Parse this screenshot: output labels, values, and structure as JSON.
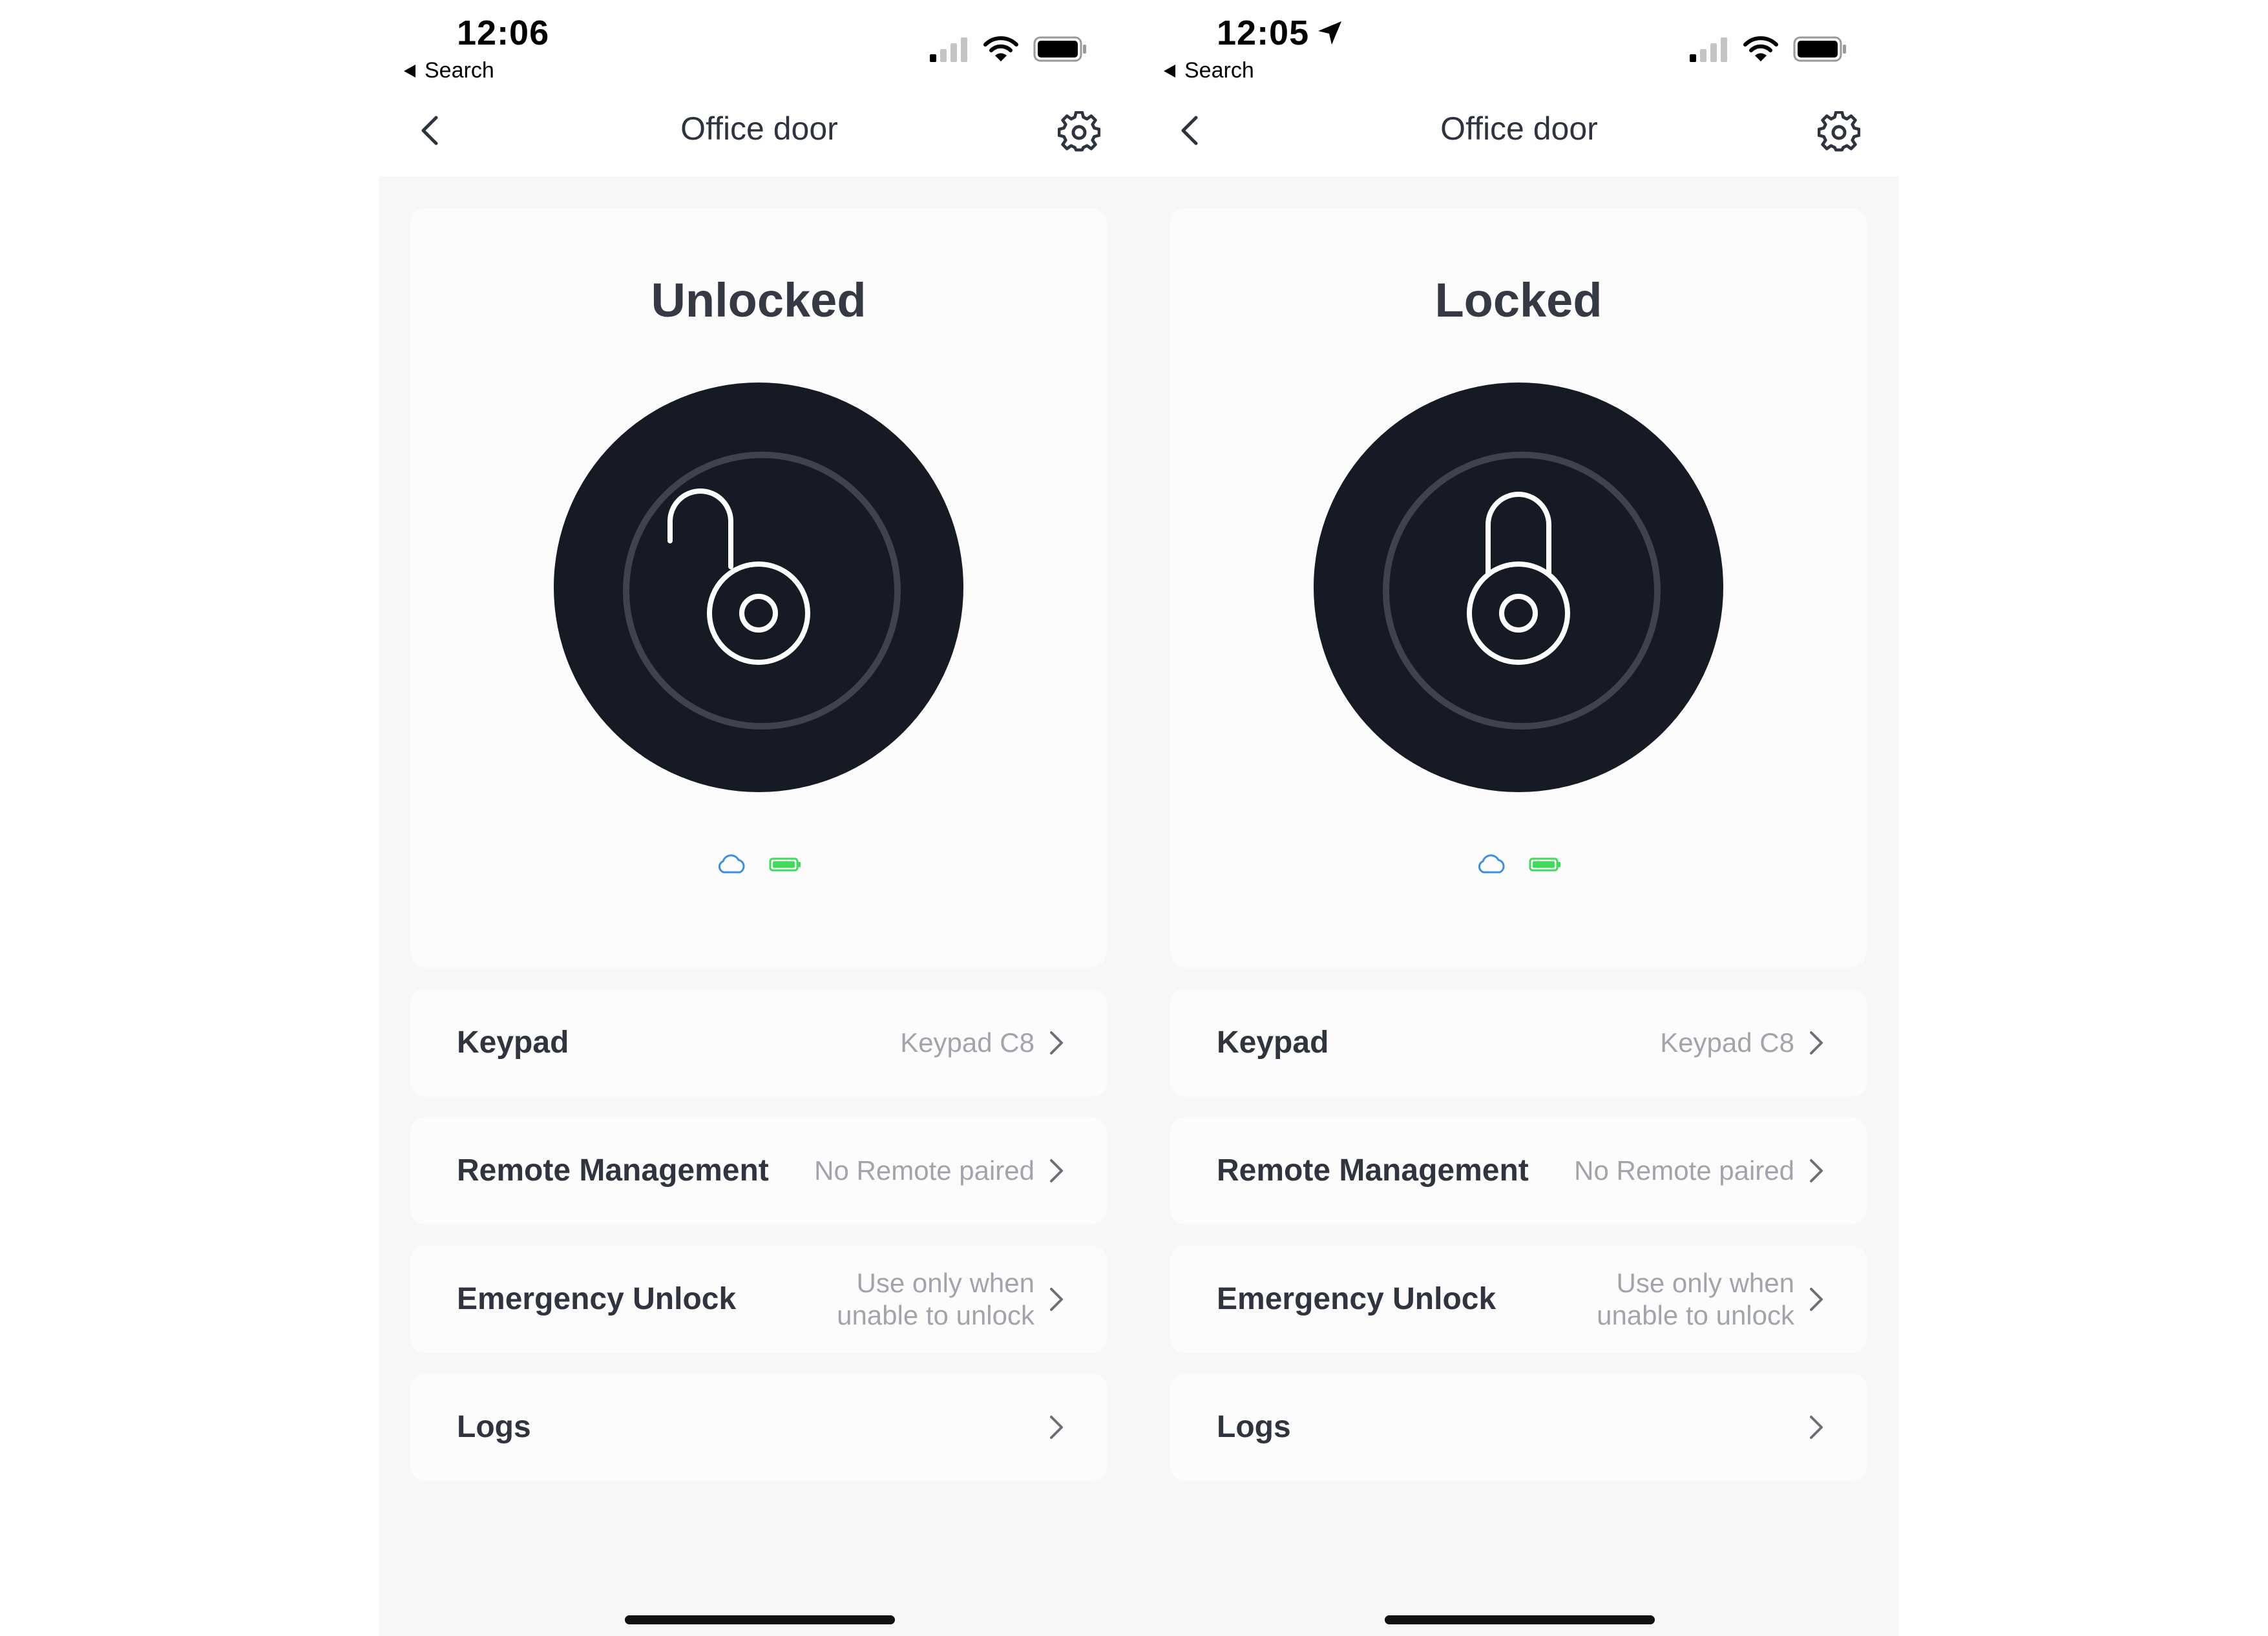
{
  "screens": [
    {
      "status_bar": {
        "time": "12:06",
        "back_app": "Search",
        "location_arrow": false
      },
      "header": {
        "title": "Office door",
        "back_icon": "chevron-left-icon",
        "settings_icon": "gear-icon"
      },
      "lock": {
        "state": "Unlocked",
        "icon": "unlocked-padlock-icon"
      },
      "indicators": {
        "cloud": "cloud-icon",
        "battery": "battery-icon",
        "cloud_color": "#3a8ee6",
        "battery_color": "#3ddc5a"
      },
      "rows": [
        {
          "label": "Keypad",
          "value": "Keypad C8"
        },
        {
          "label": "Remote Management",
          "value": "No Remote paired"
        },
        {
          "label": "Emergency Unlock",
          "value_line1": "Use only when",
          "value_line2": "unable to unlock"
        },
        {
          "label": "Logs",
          "value": ""
        }
      ]
    },
    {
      "status_bar": {
        "time": "12:05",
        "back_app": "Search",
        "location_arrow": true
      },
      "header": {
        "title": "Office door",
        "back_icon": "chevron-left-icon",
        "settings_icon": "gear-icon"
      },
      "lock": {
        "state": "Locked",
        "icon": "locked-padlock-icon"
      },
      "indicators": {
        "cloud": "cloud-icon",
        "battery": "battery-icon",
        "cloud_color": "#3a8ee6",
        "battery_color": "#3ddc5a"
      },
      "rows": [
        {
          "label": "Keypad",
          "value": "Keypad C8"
        },
        {
          "label": "Remote Management",
          "value": "No Remote paired"
        },
        {
          "label": "Emergency Unlock",
          "value_line1": "Use only when",
          "value_line2": "unable to unlock"
        },
        {
          "label": "Logs",
          "value": ""
        }
      ]
    }
  ],
  "colors": {
    "lock_button_bg": "#151a24",
    "page_bg": "#f6f7f7",
    "card_bg": "#fcfcfc",
    "label_text": "#2f343e",
    "secondary_text": "#a1a5ab"
  }
}
